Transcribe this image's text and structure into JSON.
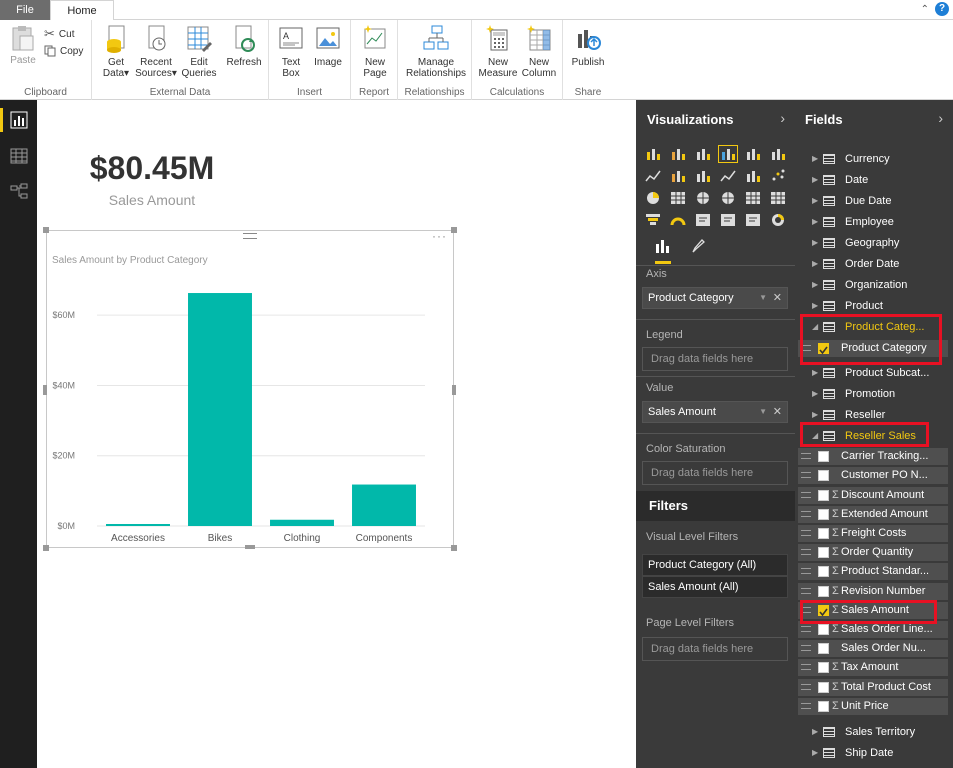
{
  "tabs": {
    "file": "File",
    "home": "Home"
  },
  "ribbon": {
    "clipboard": {
      "paste": "Paste",
      "cut": "Cut",
      "copy": "Copy",
      "group": "Clipboard"
    },
    "external": {
      "get_data_1": "Get",
      "get_data_2": "Data",
      "recent_1": "Recent",
      "recent_2": "Sources",
      "edit_1": "Edit",
      "edit_2": "Queries",
      "refresh": "Refresh",
      "group": "External Data"
    },
    "insert": {
      "text_1": "Text",
      "text_2": "Box",
      "image": "Image",
      "group": "Insert"
    },
    "report": {
      "new_1": "New",
      "new_2": "Page",
      "group": "Report"
    },
    "relationships": {
      "manage_1": "Manage",
      "manage_2": "Relationships",
      "group": "Relationships"
    },
    "calculations": {
      "measure_1": "New",
      "measure_2": "Measure",
      "column_1": "New",
      "column_2": "Column",
      "group": "Calculations"
    },
    "share": {
      "publish": "Publish",
      "group": "Share"
    }
  },
  "card": {
    "value": "$80.45M",
    "label": "Sales Amount"
  },
  "chart_data": {
    "type": "bar",
    "title": "Sales Amount by Product Category",
    "categories": [
      "Accessories",
      "Bikes",
      "Clothing",
      "Components"
    ],
    "values": [
      0.57,
      66.3,
      1.78,
      11.8
    ],
    "ytick_labels": [
      "$0M",
      "$20M",
      "$40M",
      "$60M"
    ],
    "yticks": [
      0,
      20,
      40,
      60
    ],
    "ylim": [
      0,
      72
    ],
    "grid": true,
    "color": "#01b8aa"
  },
  "visualizations": {
    "title": "Visualizations",
    "axis_label": "Axis",
    "axis_value": "Product Category",
    "legend_label": "Legend",
    "legend_placeholder": "Drag data fields here",
    "value_label": "Value",
    "value_value": "Sales Amount",
    "color_sat_label": "Color Saturation",
    "color_sat_placeholder": "Drag data fields here",
    "filters_title": "Filters",
    "visual_filters_label": "Visual Level Filters",
    "filter1": "Product Category (All)",
    "filter2": "Sales Amount (All)",
    "page_filters_label": "Page Level Filters",
    "page_filters_placeholder": "Drag data fields here"
  },
  "fields": {
    "title": "Fields",
    "tables_top": [
      "Currency",
      "Date",
      "Due Date",
      "Employee",
      "Geography",
      "Order Date",
      "Organization",
      "Product"
    ],
    "product_category_table": "Product Categ...",
    "product_category_field": "Product Category",
    "tables_mid": [
      "Product Subcat...",
      "Promotion",
      "Reseller"
    ],
    "reseller_sales_table": "Reseller Sales",
    "reseller_columns": [
      {
        "name": "Carrier Tracking...",
        "sigma": false,
        "checked": false
      },
      {
        "name": "Customer PO N...",
        "sigma": false,
        "checked": false
      },
      {
        "name": "Discount Amount",
        "sigma": true,
        "checked": false
      },
      {
        "name": "Extended Amount",
        "sigma": true,
        "checked": false
      },
      {
        "name": "Freight Costs",
        "sigma": true,
        "checked": false
      },
      {
        "name": "Order Quantity",
        "sigma": true,
        "checked": false
      },
      {
        "name": "Product Standar...",
        "sigma": true,
        "checked": false
      },
      {
        "name": "Revision Number",
        "sigma": true,
        "checked": false
      },
      {
        "name": "Sales Amount",
        "sigma": true,
        "checked": true
      },
      {
        "name": "Sales Order Line...",
        "sigma": true,
        "checked": false
      },
      {
        "name": "Sales Order Nu...",
        "sigma": false,
        "checked": false
      },
      {
        "name": "Tax Amount",
        "sigma": true,
        "checked": false
      },
      {
        "name": "Total Product Cost",
        "sigma": true,
        "checked": false
      },
      {
        "name": "Unit Price",
        "sigma": true,
        "checked": false
      }
    ],
    "tables_bottom": [
      "Sales Territory",
      "Ship Date"
    ]
  },
  "colors": {
    "accent": "#f2c811",
    "highlight": "#e81123",
    "bar": "#01b8aa"
  }
}
